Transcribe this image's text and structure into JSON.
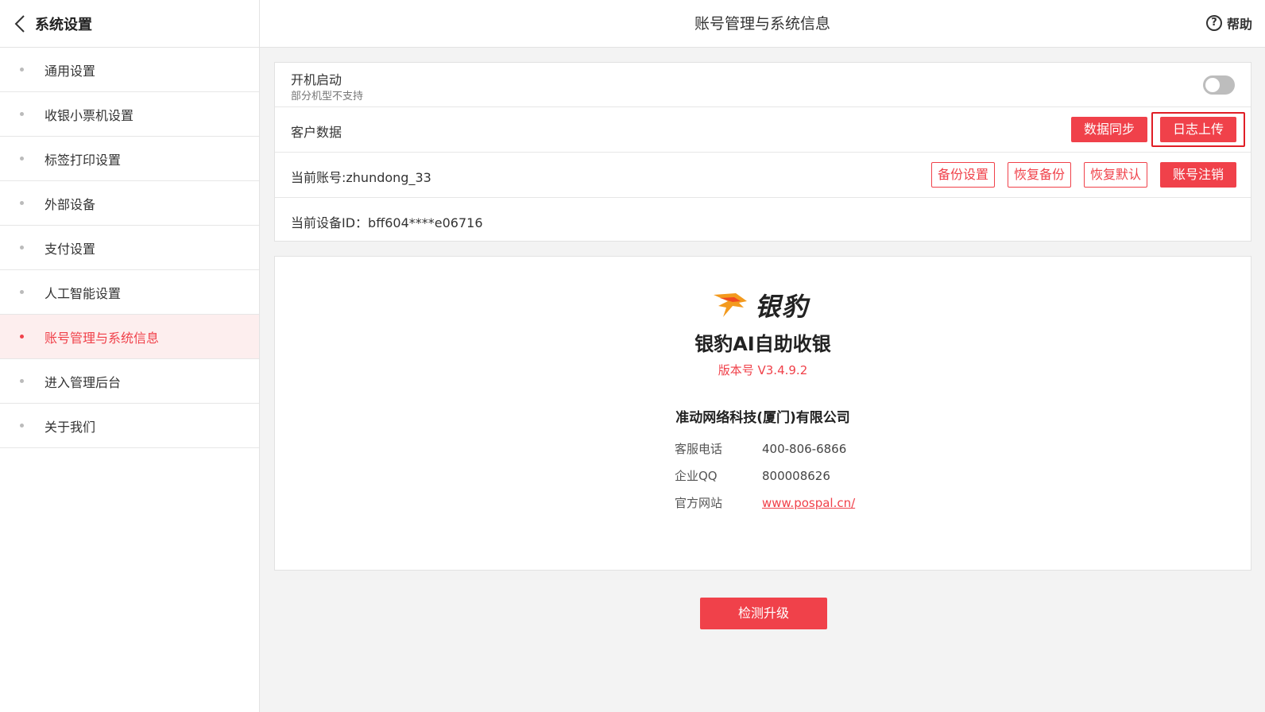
{
  "header": {
    "back_title": "系统设置",
    "page_title": "账号管理与系统信息",
    "help_label": "帮助"
  },
  "sidebar": {
    "items": [
      {
        "label": "通用设置"
      },
      {
        "label": "收银小票机设置"
      },
      {
        "label": "标签打印设置"
      },
      {
        "label": "外部设备"
      },
      {
        "label": "支付设置"
      },
      {
        "label": "人工智能设置"
      },
      {
        "label": "账号管理与系统信息",
        "active": true
      },
      {
        "label": "进入管理后台"
      },
      {
        "label": "关于我们"
      }
    ]
  },
  "settings": {
    "autostart_label": "开机启动",
    "autostart_note": "部分机型不支持",
    "autostart_enabled": false,
    "customer_data_label": "客户数据",
    "data_sync_button": "数据同步",
    "log_upload_button": "日志上传",
    "account_label": "当前账号:zhundong_33",
    "backup_settings_button": "备份设置",
    "restore_backup_button": "恢复备份",
    "restore_default_button": "恢复默认",
    "logout_button": "账号注销",
    "device_id_label": "当前设备ID：bff604****e06716"
  },
  "about": {
    "logo_brand": "银豹",
    "app_name": "银豹AI自助收银",
    "version": "版本号 V3.4.9.2",
    "company": "准动网络科技(厦门)有限公司",
    "phone_label": "客服电话",
    "phone_value": "400-806-6866",
    "qq_label": "企业QQ",
    "qq_value": "800008626",
    "website_label": "官方网站",
    "website_value": "www.pospal.cn/"
  },
  "upgrade_button": "检测升级",
  "colors": {
    "accent": "#f0414a",
    "highlight_border": "#e01e26"
  }
}
